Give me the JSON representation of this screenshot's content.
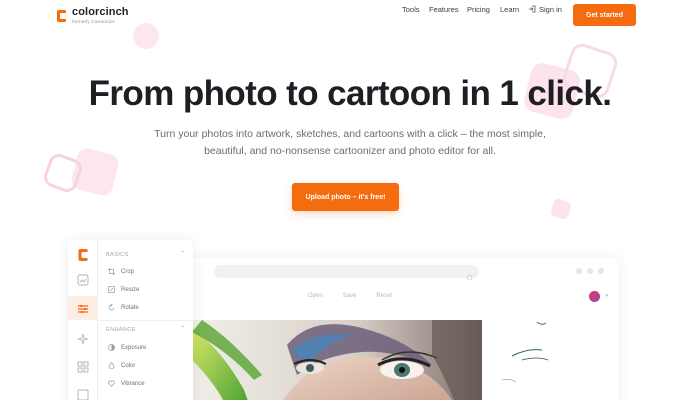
{
  "brand": {
    "name": "colorcinch",
    "sub": "formerly Cartoonize",
    "color": "#f46c0f"
  },
  "nav": {
    "tools": "Tools",
    "features": "Features",
    "pricing": "Pricing",
    "learn": "Learn",
    "signin": "Sign in",
    "cta": "Get started"
  },
  "hero": {
    "title": "From photo to cartoon in 1 click.",
    "subtitle": "Turn your photos into artwork, sketches, and cartoons with a click – the most simple, beautiful, and no-nonsense cartoonizer and photo editor for all.",
    "upload": "Upload photo – it's free!"
  },
  "editor": {
    "toolbar": [
      "Open",
      "Save",
      "Reset"
    ],
    "basics": {
      "title": "BASICS",
      "items": [
        "Crop",
        "Resize",
        "Rotate"
      ]
    },
    "enhance": {
      "title": "ENHANCE",
      "items": [
        "Exposure",
        "Color",
        "Vibrance"
      ]
    }
  },
  "icons": [
    "logo-icon",
    "signin-icon",
    "crop-icon",
    "resize-icon",
    "rotate-icon",
    "exposure-icon",
    "color-icon",
    "vibrance-icon"
  ]
}
